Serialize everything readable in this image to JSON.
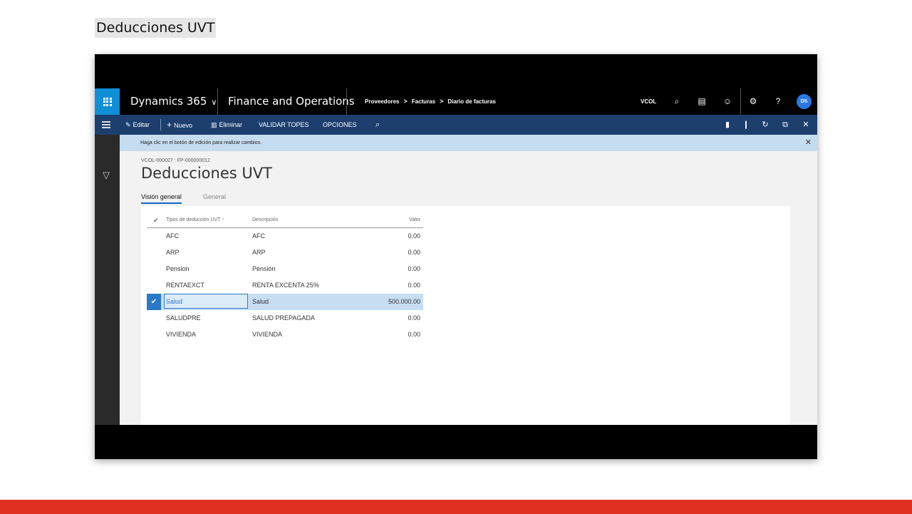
{
  "document": {
    "title": "Deducciones UVT"
  },
  "navbar": {
    "app_name": "Dynamics 365",
    "module": "Finance and Operations",
    "breadcrumbs": [
      "Proveedores",
      "Facturas",
      "Diario de facturas"
    ],
    "company": "VCOL",
    "user_initials": "DS",
    "icons": [
      "app-launcher-icon",
      "chevron-down-icon",
      "search-icon",
      "message-icon",
      "smiley-icon",
      "gear-icon",
      "help-icon"
    ]
  },
  "commandbar": {
    "edit": "Editar",
    "new": "Nuevo",
    "delete": "Eliminar",
    "validate": "VALIDAR TOPES",
    "options": "OPCIONES",
    "icons": [
      "hamburger-icon",
      "pencil-icon",
      "plus-icon",
      "trash-icon",
      "search-icon",
      "office-icon",
      "attachment-icon",
      "refresh-icon",
      "popout-icon",
      "close-icon"
    ]
  },
  "message": {
    "text": "Haga clic en el botón de edición para realizar cambios."
  },
  "record": {
    "id": "VCOL-000027 : FP-000000012",
    "title": "Deducciones UVT"
  },
  "tabs": [
    "Visión general",
    "General"
  ],
  "grid": {
    "headers": {
      "code": "Tipos de deducción UVT",
      "desc": "Descripción",
      "value": "Valor",
      "sort_indicator": "↑"
    },
    "rows": [
      {
        "code": "AFC",
        "desc": "AFC",
        "value": "0.00"
      },
      {
        "code": "ARP",
        "desc": "ARP",
        "value": "0.00"
      },
      {
        "code": "Pension",
        "desc": "Pensión",
        "value": "0.00"
      },
      {
        "code": "RENTAEXCT",
        "desc": "RENTA EXCENTA 25%",
        "value": "0.00"
      },
      {
        "code": "Salud",
        "desc": "Salud",
        "value": "500.000.00",
        "selected": true
      },
      {
        "code": "SALUDPRE",
        "desc": "SALUD PREPAGADA",
        "value": "0.00"
      },
      {
        "code": "VIVIENDA",
        "desc": "VIVIENDA",
        "value": "0.00"
      }
    ]
  },
  "colors": {
    "nav_bg": "#000000",
    "waffle": "#0f8fd6",
    "command_bar": "#1c3f6e",
    "message_bar": "#c6dcef",
    "selected_row": "#c7ddf2",
    "accent": "#2b78c8",
    "footer_band": "#e03020"
  }
}
